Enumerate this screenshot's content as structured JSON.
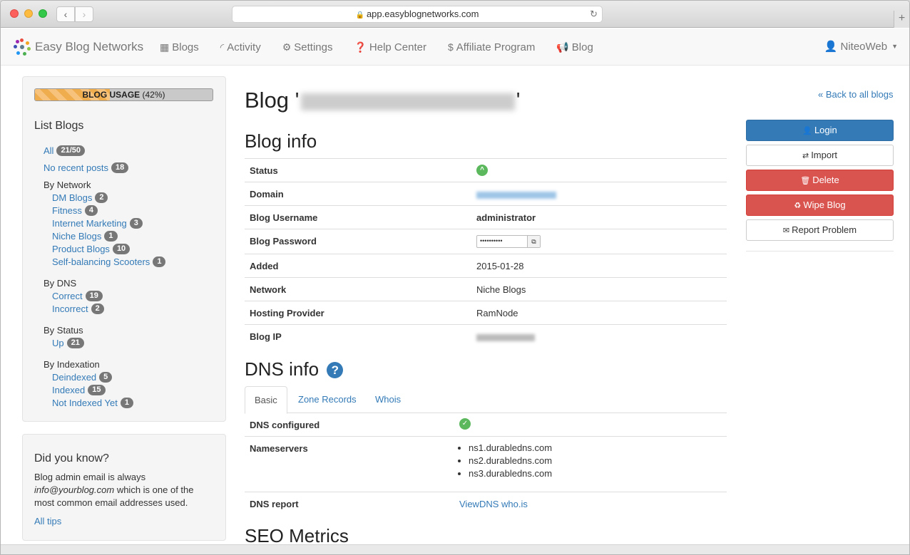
{
  "browser": {
    "url": "app.easyblognetworks.com"
  },
  "navbar": {
    "brand": "Easy Blog Networks",
    "items": [
      {
        "label": "Blogs",
        "icon": "grid-icon"
      },
      {
        "label": "Activity",
        "icon": "rss-icon"
      },
      {
        "label": "Settings",
        "icon": "gear-icon"
      },
      {
        "label": "Help Center",
        "icon": "question-circle-icon"
      },
      {
        "label": "Affiliate Program",
        "icon": "dollar-icon"
      },
      {
        "label": "Blog",
        "icon": "bullhorn-icon"
      }
    ],
    "user": "NiteoWeb"
  },
  "sidebar": {
    "usage_label": "BLOG USAGE",
    "usage_pct_text": "(42%)",
    "usage_fraction": 0.42,
    "title": "List Blogs",
    "all_label": "All",
    "all_count": "21/50",
    "no_recent_label": "No recent posts",
    "no_recent_count": "18",
    "by_network": "By Network",
    "networks": [
      {
        "label": "DM Blogs",
        "count": "2"
      },
      {
        "label": "Fitness",
        "count": "4"
      },
      {
        "label": "Internet Marketing",
        "count": "3"
      },
      {
        "label": "Niche Blogs",
        "count": "1"
      },
      {
        "label": "Product Blogs",
        "count": "10"
      },
      {
        "label": "Self-balancing Scooters",
        "count": "1"
      }
    ],
    "by_dns": "By DNS",
    "dns": [
      {
        "label": "Correct",
        "count": "19"
      },
      {
        "label": "Incorrect",
        "count": "2"
      }
    ],
    "by_status": "By Status",
    "status": [
      {
        "label": "Up",
        "count": "21"
      }
    ],
    "by_indexation": "By Indexation",
    "indexation": [
      {
        "label": "Deindexed",
        "count": "5"
      },
      {
        "label": "Indexed",
        "count": "15"
      },
      {
        "label": "Not Indexed Yet",
        "count": "1"
      }
    ]
  },
  "tips": {
    "title": "Did you know?",
    "text_before": "Blog admin email is always ",
    "email": "info@yourblog.com",
    "text_after": " which is one of the most common email addresses used.",
    "all_tips": "All tips"
  },
  "main": {
    "title_prefix": "Blog '",
    "title_suffix": "'",
    "blog_info_heading": "Blog info",
    "info_rows": {
      "status": "Status",
      "domain": "Domain",
      "username_label": "Blog Username",
      "username": "administrator",
      "password_label": "Blog Password",
      "password_mask": "••••••••••",
      "added_label": "Added",
      "added": "2015-01-28",
      "network_label": "Network",
      "network": "Niche Blogs",
      "hosting_label": "Hosting Provider",
      "hosting": "RamNode",
      "ip_label": "Blog IP"
    },
    "dns_heading": "DNS info",
    "tabs": [
      "Basic",
      "Zone Records",
      "Whois"
    ],
    "dns_configured": "DNS configured",
    "nameservers_label": "Nameservers",
    "nameservers": [
      "ns1.durabledns.com",
      "ns2.durabledns.com",
      "ns3.durabledns.com"
    ],
    "dns_report_label": "DNS report",
    "dns_report_link": "ViewDNS who.is",
    "seo_heading": "SEO Metrics"
  },
  "right": {
    "back_link": "Back to all blogs",
    "buttons": {
      "login": "Login",
      "import": "Import",
      "delete": "Delete",
      "wipe": "Wipe Blog",
      "report": "Report Problem"
    }
  },
  "colors": {
    "primary": "#337ab7",
    "danger": "#d9534f",
    "success": "#5cb85c",
    "warning": "#f0ad4e"
  }
}
